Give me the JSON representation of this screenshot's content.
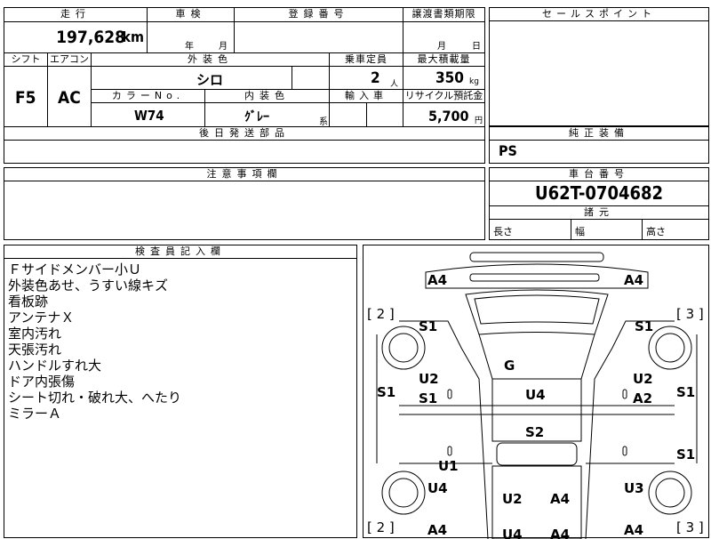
{
  "main": {
    "mileage_header": "走行",
    "mileage_value": "197,628",
    "mileage_unit": "km",
    "inspection_header": "車検",
    "inspection_year": "年",
    "inspection_month": "月",
    "registration_header": "登録番号",
    "transfer_header": "譲渡書類期限",
    "transfer_month": "月",
    "transfer_day": "日",
    "shift_header": "シフト",
    "shift_value": "F5",
    "ac_header": "エアコン",
    "ac_value": "AC",
    "exterior_color_header": "外装色",
    "exterior_color_value": "シロ",
    "capacity_header": "乗車定員",
    "capacity_value": "2",
    "capacity_unit": "人",
    "max_load_header": "最大積載量",
    "max_load_value": "350",
    "max_load_unit": "kg",
    "color_no_header": "カラーNo.",
    "color_no_value": "W74",
    "interior_color_header": "内装色",
    "interior_color_value": "ｸﾞﾚｰ",
    "interior_color_suffix": "系",
    "import_header": "輸入車",
    "recycle_header": "リサイクル預託金",
    "recycle_value": "5,700",
    "recycle_unit": "円",
    "followup_header": "後日発送部品",
    "notes_header": "注意事項欄",
    "inspector_header": "検査員記入欄",
    "inspector_remarks": [
      "Ｆサイドメンバー小Ｕ",
      "外装色あせ、うすい線キズ",
      "看板跡",
      "アンテナＸ",
      "室内汚れ",
      "天張汚れ",
      "ハンドルすれ大",
      "ドア内張傷",
      "シート切れ・破れ大、へたり",
      "ミラーＡ"
    ]
  },
  "right": {
    "sales_point_header": "セールスポイント",
    "equipment_header": "純正装備",
    "equipment_value": "PS",
    "chassis_header": "車台番号",
    "chassis_value": "U62T-0704682",
    "dimensions_header": "諸元",
    "length_label": "長さ",
    "width_label": "幅",
    "height_label": "高さ"
  },
  "diagram": {
    "labels": [
      "A4",
      "A4",
      "[ 2 ]",
      "[ 3 ]",
      "S1",
      "S1",
      "G",
      "U2",
      "U2",
      "S1",
      "S1",
      "A2",
      "U4",
      "S1",
      "S2",
      "U1",
      "S1",
      "U4",
      "U3",
      "U2",
      "A4",
      "[ 2 ]",
      "[ 3 ]",
      "A4",
      "A4",
      "U4",
      "A4"
    ]
  }
}
